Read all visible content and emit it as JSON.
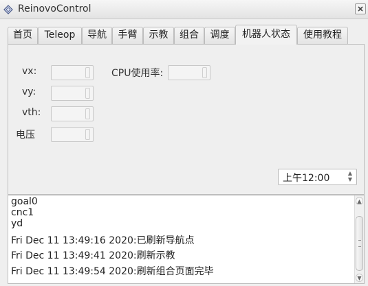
{
  "window": {
    "title": "ReinovoControl",
    "close_icon": "close-icon"
  },
  "tabs": [
    {
      "label": "首页"
    },
    {
      "label": "Teleop"
    },
    {
      "label": "导航"
    },
    {
      "label": "手臂"
    },
    {
      "label": "示教"
    },
    {
      "label": "组合"
    },
    {
      "label": "调度"
    },
    {
      "label": "机器人状态",
      "active": true
    },
    {
      "label": "使用教程"
    }
  ],
  "status": {
    "vx_label": "vx:",
    "vy_label": "vy:",
    "vth_label": "vth:",
    "voltage_label": "电压",
    "cpu_label": "CPU使用率:",
    "vx_value": "",
    "vy_value": "",
    "vth_value": "",
    "voltage_value": "",
    "cpu_value": "",
    "time_value": "上午12:00"
  },
  "log": {
    "lines": [
      "goal0",
      "cnc1",
      "yd",
      "Fri Dec 11 13:49:16 2020:已刷新导航点",
      "Fri Dec 11 13:49:41 2020:刷新示教",
      "Fri Dec 11 13:49:54 2020:刷新组合页面完毕"
    ]
  }
}
